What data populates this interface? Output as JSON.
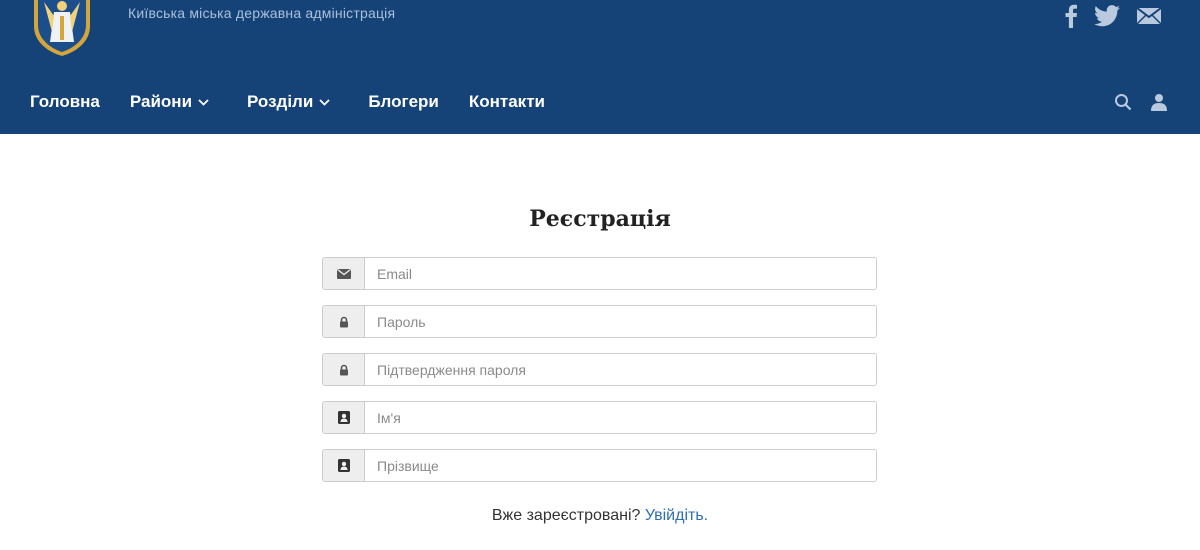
{
  "header": {
    "org_name": "Київська міська державна адміністрація",
    "logo_icon": "kyiv-coat-of-arms-icon",
    "social": [
      {
        "name": "facebook-icon"
      },
      {
        "name": "twitter-icon"
      },
      {
        "name": "mail-icon"
      }
    ],
    "background_color": "#154377"
  },
  "nav": {
    "items": [
      {
        "label": "Головна",
        "has_dropdown": false
      },
      {
        "label": "Райони",
        "has_dropdown": true
      },
      {
        "label": "Розділи",
        "has_dropdown": true
      },
      {
        "label": "Блогери",
        "has_dropdown": false
      },
      {
        "label": "Контакти",
        "has_dropdown": false
      }
    ],
    "tools": [
      "search-icon",
      "user-icon"
    ]
  },
  "form": {
    "title": "Реєстрація",
    "fields": [
      {
        "icon": "envelope-icon",
        "placeholder": "Email",
        "value": ""
      },
      {
        "icon": "lock-icon",
        "placeholder": "Пароль",
        "value": ""
      },
      {
        "icon": "lock-icon",
        "placeholder": "Підтвердження пароля",
        "value": ""
      },
      {
        "icon": "contact-card-icon",
        "placeholder": "Ім'я",
        "value": ""
      },
      {
        "icon": "contact-card-icon",
        "placeholder": "Прізвище",
        "value": ""
      }
    ],
    "already_registered": "Вже зареєстровані?",
    "login_link": "Увійдіть."
  }
}
